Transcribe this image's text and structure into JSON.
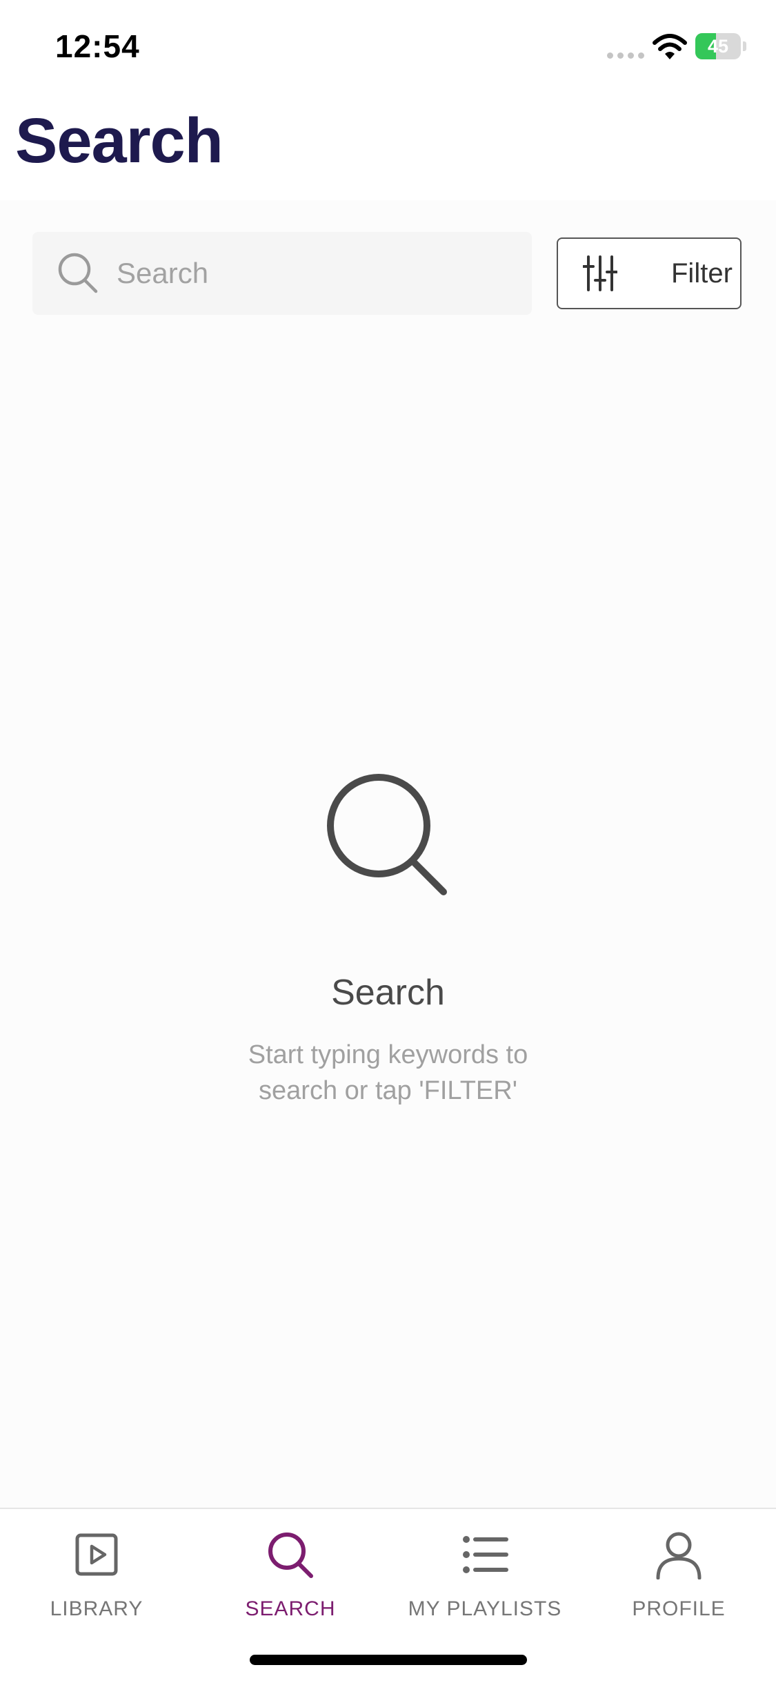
{
  "status_bar": {
    "time": "12:54",
    "battery_level": "45",
    "battery_fraction": 0.45
  },
  "header": {
    "title": "Search"
  },
  "search": {
    "placeholder": "Search",
    "value": ""
  },
  "filter": {
    "label": "Filter"
  },
  "empty_state": {
    "title": "Search",
    "message": "Start typing keywords to search or tap 'FILTER'"
  },
  "tabs": [
    {
      "label": "LIBRARY",
      "icon": "play-square-icon",
      "active": false
    },
    {
      "label": "SEARCH",
      "icon": "search-icon",
      "active": true
    },
    {
      "label": "MY PLAYLISTS",
      "icon": "list-icon",
      "active": false
    },
    {
      "label": "PROFILE",
      "icon": "person-icon",
      "active": false
    }
  ],
  "colors": {
    "title": "#1e1a4e",
    "active_tab": "#7c1d6f",
    "inactive_tab": "#767676",
    "battery_fill": "#34c759"
  }
}
